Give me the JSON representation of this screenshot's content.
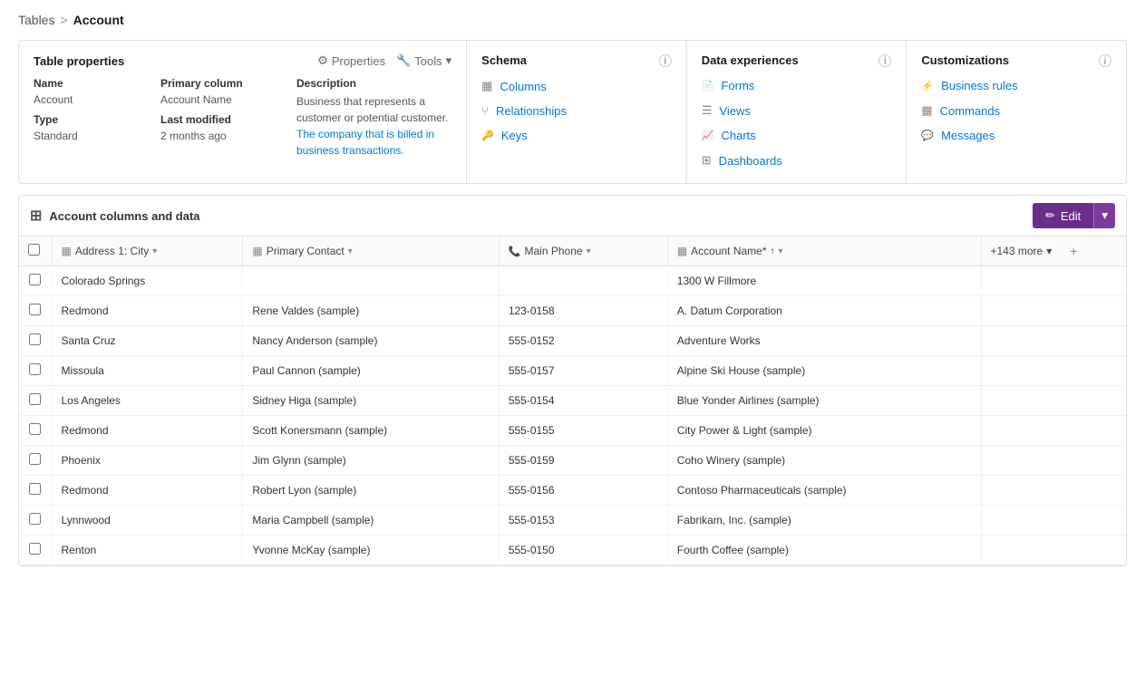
{
  "breadcrumb": {
    "link": "Tables",
    "sep": ">",
    "current": "Account"
  },
  "tableProps": {
    "sectionTitle": "Table properties",
    "actions": {
      "properties": "Properties",
      "tools": "Tools"
    },
    "columns": {
      "name": "Name",
      "primaryColumn": "Primary column",
      "description": "Description"
    },
    "values": {
      "name": "Account",
      "primaryColumn": "Account Name",
      "type": "Type",
      "typeValue": "Standard",
      "lastModified": "Last modified",
      "lastModifiedValue": "2 months ago",
      "description1": "Business that represents a customer or potential customer.",
      "description2": "The company that is billed in business transactions."
    }
  },
  "schema": {
    "title": "Schema",
    "items": [
      {
        "label": "Columns",
        "icon": "grid"
      },
      {
        "label": "Relationships",
        "icon": "fork"
      },
      {
        "label": "Keys",
        "icon": "key"
      }
    ]
  },
  "dataExperiences": {
    "title": "Data experiences",
    "items": [
      {
        "label": "Forms",
        "icon": "form"
      },
      {
        "label": "Views",
        "icon": "view"
      },
      {
        "label": "Charts",
        "icon": "chart"
      },
      {
        "label": "Dashboards",
        "icon": "dashboard"
      }
    ]
  },
  "customizations": {
    "title": "Customizations",
    "items": [
      {
        "label": "Business rules",
        "icon": "rules"
      },
      {
        "label": "Commands",
        "icon": "commands"
      },
      {
        "label": "Messages",
        "icon": "messages"
      }
    ]
  },
  "dataSection": {
    "title": "Account columns and data",
    "editBtn": "Edit"
  },
  "table": {
    "columns": [
      {
        "label": "Address 1: City",
        "icon": "col"
      },
      {
        "label": "Primary Contact",
        "icon": "col"
      },
      {
        "label": "Main Phone",
        "icon": "phone"
      },
      {
        "label": "Account Name*",
        "icon": "col",
        "sort": "↑"
      },
      {
        "label": "+143 more",
        "isMore": true
      }
    ],
    "rows": [
      {
        "city": "Colorado Springs",
        "contact": "",
        "phone": "",
        "accountName": "1300 W Fillmore",
        "contactLink": false
      },
      {
        "city": "Redmond",
        "contact": "Rene Valdes (sample)",
        "phone": "123-0158",
        "accountName": "A. Datum Corporation",
        "contactLink": true
      },
      {
        "city": "Santa Cruz",
        "contact": "Nancy Anderson (sample)",
        "phone": "555-0152",
        "accountName": "Adventure Works",
        "contactLink": true
      },
      {
        "city": "Missoula",
        "contact": "Paul Cannon (sample)",
        "phone": "555-0157",
        "accountName": "Alpine Ski House (sample)",
        "contactLink": true
      },
      {
        "city": "Los Angeles",
        "contact": "Sidney Higa (sample)",
        "phone": "555-0154",
        "accountName": "Blue Yonder Airlines (sample)",
        "contactLink": true
      },
      {
        "city": "Redmond",
        "contact": "Scott Konersmann (sample)",
        "phone": "555-0155",
        "accountName": "City Power & Light (sample)",
        "contactLink": false
      },
      {
        "city": "Phoenix",
        "contact": "Jim Glynn (sample)",
        "phone": "555-0159",
        "accountName": "Coho Winery (sample)",
        "contactLink": true
      },
      {
        "city": "Redmond",
        "contact": "Robert Lyon (sample)",
        "phone": "555-0156",
        "accountName": "Contoso Pharmaceuticals (sample)",
        "contactLink": true
      },
      {
        "city": "Lynnwood",
        "contact": "Maria Campbell (sample)",
        "phone": "555-0153",
        "accountName": "Fabrikam, Inc. (sample)",
        "contactLink": true
      },
      {
        "city": "Renton",
        "contact": "Yvonne McKay (sample)",
        "phone": "555-0150",
        "accountName": "Fourth Coffee (sample)",
        "contactLink": true
      }
    ]
  },
  "icons": {
    "gear": "⚙",
    "tools": "🔧",
    "chevron_down": "▾",
    "edit_pencil": "✏",
    "grid_icon": "⊞",
    "fork_icon": "⑂",
    "key_icon": "🗝",
    "form_icon": "📄",
    "view_icon": "☰",
    "chart_icon": "📈",
    "dashboard_icon": "⊞",
    "rules_icon": "⚡",
    "commands_icon": "▦",
    "messages_icon": "💬",
    "phone_icon": "📞",
    "col_icon": "▦",
    "sort_up": "↑",
    "plus": "+"
  }
}
